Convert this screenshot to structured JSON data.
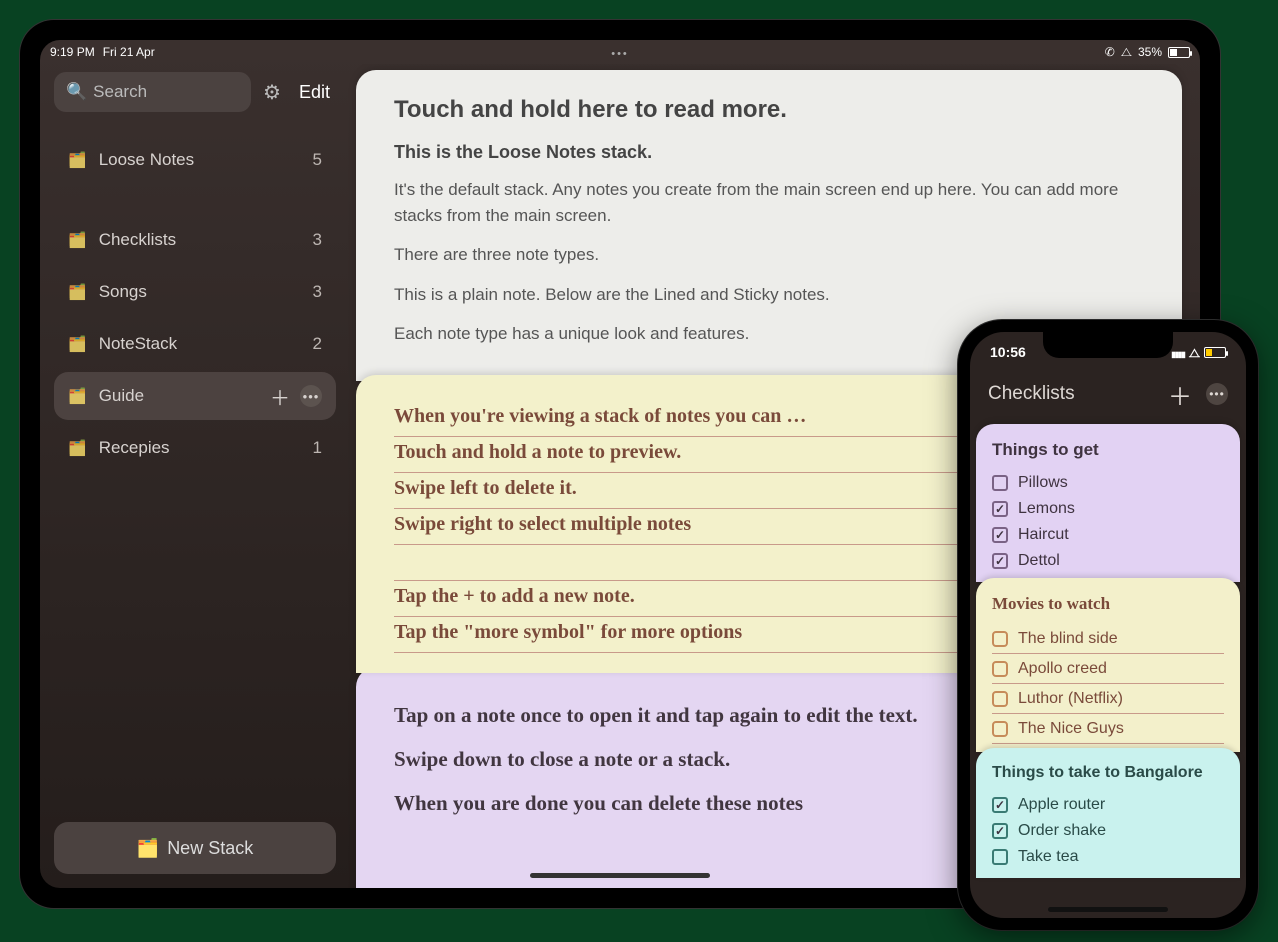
{
  "ipad": {
    "status": {
      "time": "9:19 PM",
      "date": "Fri 21 Apr",
      "battery": "35%"
    },
    "search_placeholder": "Search",
    "edit": "Edit",
    "new_stack": "New Stack",
    "stacks": [
      {
        "label": "Loose Notes",
        "count": "5"
      },
      {
        "label": "Checklists",
        "count": "3"
      },
      {
        "label": "Songs",
        "count": "3"
      },
      {
        "label": "NoteStack",
        "count": "2"
      },
      {
        "label": "Guide",
        "count": ""
      },
      {
        "label": "Recepies",
        "count": "1"
      }
    ],
    "note_white": {
      "title": "Touch and hold here to read more.",
      "subtitle": "This is the Loose Notes stack.",
      "p1": "It's the default stack. Any notes you create from the main screen end up here. You can add more stacks from the main screen.",
      "p2": "There are three note types.",
      "p3": "This is a plain note. Below are the Lined and Sticky notes.",
      "p4": "Each note type has a unique look and features."
    },
    "note_yellow": {
      "l1": "When you're viewing a stack of notes you can …",
      "l2": "Touch and hold a note to preview.",
      "l3": "Swipe left to delete it.",
      "l4": "Swipe right to select multiple notes",
      "l5": "Tap the + to add a new note.",
      "l6": "Tap the \"more symbol\" for more options"
    },
    "note_purple": {
      "l1": "Tap on a note once to open it and tap again to edit the text.",
      "l2": "Swipe down to close a note or a stack.",
      "l3": "When you are done you can delete these notes"
    }
  },
  "iphone": {
    "status": {
      "time": "10:56"
    },
    "header": {
      "title": "Checklists"
    },
    "card1": {
      "title": "Things to get",
      "items": [
        {
          "label": "Pillows",
          "checked": false
        },
        {
          "label": "Lemons",
          "checked": true
        },
        {
          "label": "Haircut",
          "checked": true
        },
        {
          "label": "Dettol",
          "checked": true
        }
      ]
    },
    "card2": {
      "title": "Movies to watch",
      "items": [
        {
          "label": "The blind side"
        },
        {
          "label": "Apollo creed"
        },
        {
          "label": "Luthor (Netflix)"
        },
        {
          "label": "The Nice Guys"
        }
      ]
    },
    "card3": {
      "title": "Things to take to Bangalore",
      "items": [
        {
          "label": "Apple router",
          "checked": true
        },
        {
          "label": "Order shake",
          "checked": true
        },
        {
          "label": "Take tea",
          "checked": false
        }
      ]
    }
  }
}
